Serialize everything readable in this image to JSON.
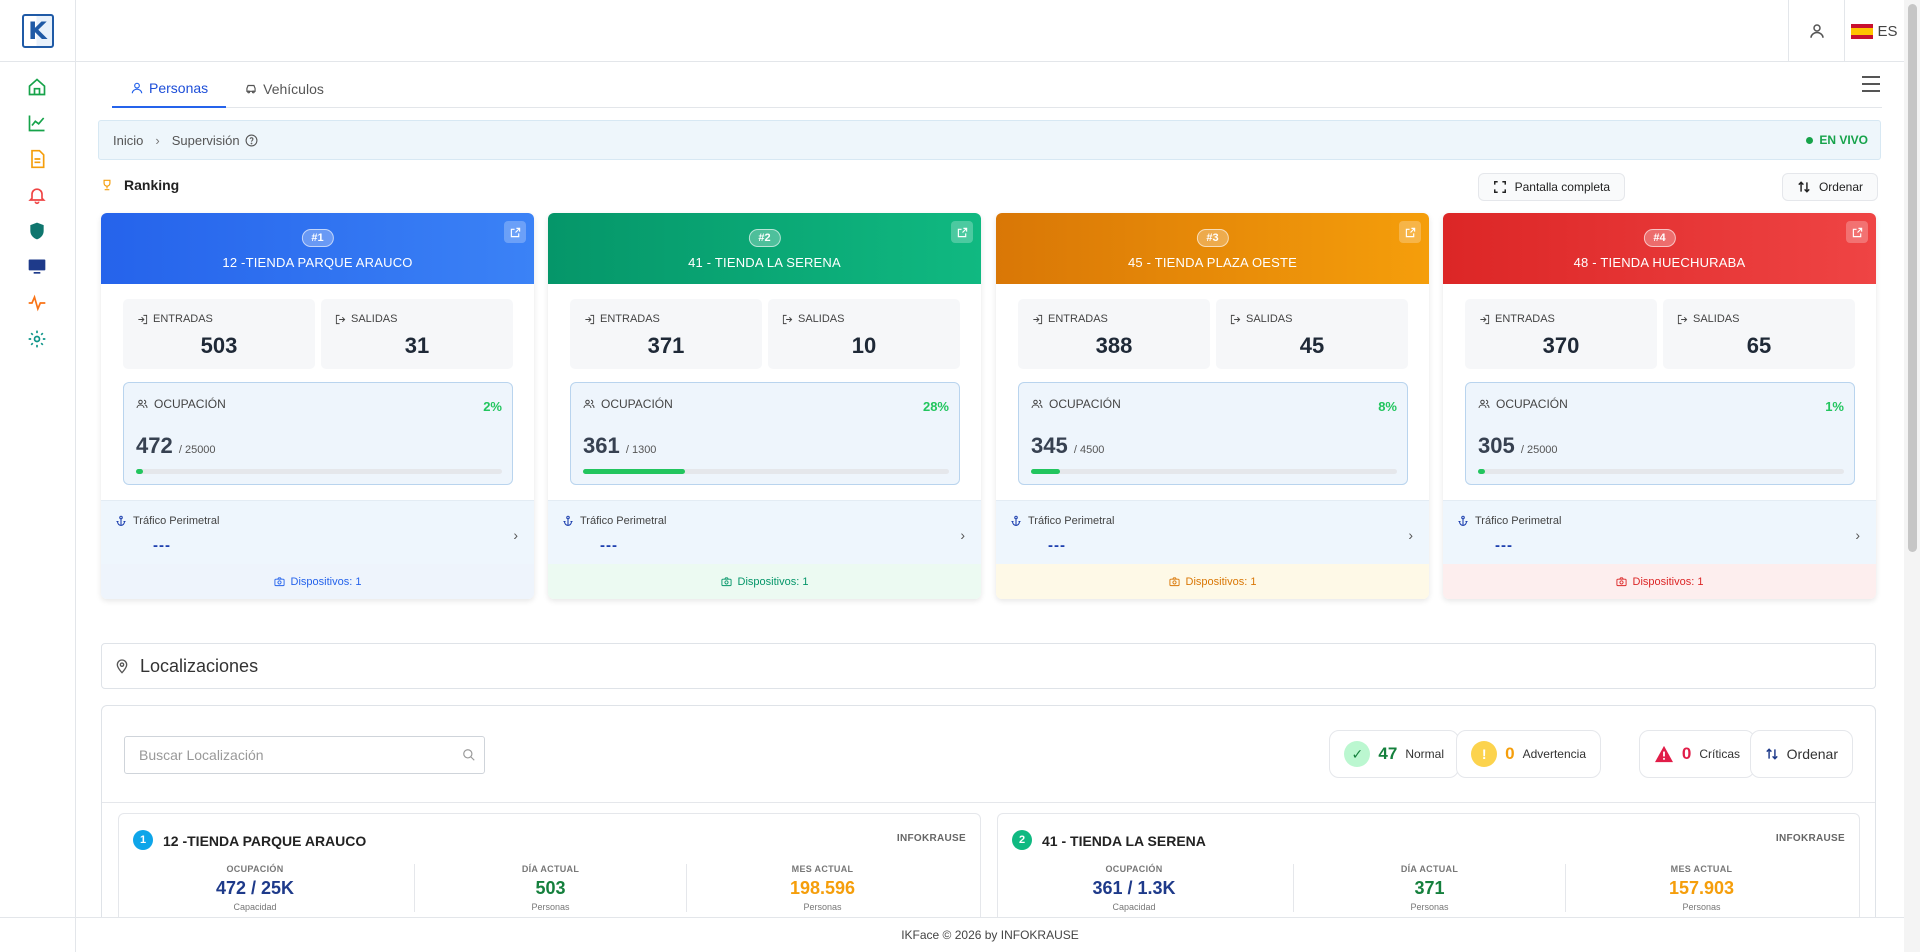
{
  "app": {
    "logo_letter": "K"
  },
  "top": {
    "language": "ES"
  },
  "sidebar": {
    "items": [
      "home-icon",
      "chart-icon",
      "document-icon",
      "bell-icon",
      "shield-icon",
      "monitor-icon",
      "activity-icon",
      "gear-icon"
    ]
  },
  "tabs": [
    {
      "label": "Personas",
      "active": true
    },
    {
      "label": "Vehículos",
      "active": false
    }
  ],
  "breadcrumb": {
    "home": "Inicio",
    "current": "Supervisión",
    "live": "EN VIVO"
  },
  "ranking": {
    "title": "Ranking",
    "fullscreen_label": "Pantalla completa",
    "sort_label": "Ordenar"
  },
  "stores": [
    {
      "rank": "#1",
      "name": "12 -TIENDA PARQUE ARAUCO",
      "entradas_label": "ENTRADAS",
      "entradas": "503",
      "salidas_label": "SALIDAS",
      "salidas": "31",
      "occ_label": "OCUPACIÓN",
      "occ_pct": "2%",
      "occ_value": "472",
      "occ_cap": "/ 25000",
      "occ_fraction": 0.02,
      "perim_label": "Tráfico Perimetral",
      "perim_value": "---",
      "devices": "Dispositivos: 1",
      "color": "#3b82f6"
    },
    {
      "rank": "#2",
      "name": "41 - TIENDA LA SERENA",
      "entradas_label": "ENTRADAS",
      "entradas": "371",
      "salidas_label": "SALIDAS",
      "salidas": "10",
      "occ_label": "OCUPACIÓN",
      "occ_pct": "28%",
      "occ_value": "361",
      "occ_cap": "/ 1300",
      "occ_fraction": 0.28,
      "perim_label": "Tráfico Perimetral",
      "perim_value": "---",
      "devices": "Dispositivos: 1",
      "color": "#10b981"
    },
    {
      "rank": "#3",
      "name": "45 - TIENDA PLAZA OESTE",
      "entradas_label": "ENTRADAS",
      "entradas": "388",
      "salidas_label": "SALIDAS",
      "salidas": "45",
      "occ_label": "OCUPACIÓN",
      "occ_pct": "8%",
      "occ_value": "345",
      "occ_cap": "/ 4500",
      "occ_fraction": 0.08,
      "perim_label": "Tráfico Perimetral",
      "perim_value": "---",
      "devices": "Dispositivos: 1",
      "color": "#f59e0b"
    },
    {
      "rank": "#4",
      "name": "48 - TIENDA HUECHURABA",
      "entradas_label": "ENTRADAS",
      "entradas": "370",
      "salidas_label": "SALIDAS",
      "salidas": "65",
      "occ_label": "OCUPACIÓN",
      "occ_pct": "1%",
      "occ_value": "305",
      "occ_cap": "/ 25000",
      "occ_fraction": 0.01,
      "perim_label": "Tráfico Perimetral",
      "perim_value": "---",
      "devices": "Dispositivos: 1",
      "color": "#ef4444"
    }
  ],
  "locations": {
    "title": "Localizaciones",
    "search_placeholder": "Buscar Localización",
    "normal_count": "47",
    "normal_label": "Normal",
    "warning_count": "0",
    "warning_label": "Advertencia",
    "critical_count": "0",
    "critical_label": "Críticas",
    "sort_label": "Ordenar",
    "cards": [
      {
        "num": "1",
        "name": "12 -TIENDA PARQUE ARAUCO",
        "org": "INFOKRAUSE",
        "m1_label": "OCUPACIÓN",
        "m1_value": "472 / 25K",
        "m1_sub": "Capacidad",
        "m2_label": "DÍA ACTUAL",
        "m2_value": "503",
        "m2_sub": "Personas",
        "m3_label": "MES ACTUAL",
        "m3_value": "198.596",
        "m3_sub": "Personas"
      },
      {
        "num": "2",
        "name": "41 - TIENDA LA SERENA",
        "org": "INFOKRAUSE",
        "m1_label": "OCUPACIÓN",
        "m1_value": "361 / 1.3K",
        "m1_sub": "Capacidad",
        "m2_label": "DÍA ACTUAL",
        "m2_value": "371",
        "m2_sub": "Personas",
        "m3_label": "MES ACTUAL",
        "m3_value": "157.903",
        "m3_sub": "Personas"
      }
    ]
  },
  "footer": {
    "text": "IKFace © 2026 by INFOKRAUSE"
  }
}
